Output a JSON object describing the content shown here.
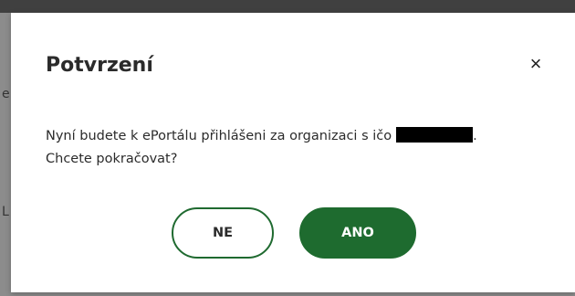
{
  "dialog": {
    "title": "Potvrzení",
    "close_symbol": "×",
    "message_line1_before_redaction": "Nyní budete k ePortálu přihlášeni za organizaci s ičo",
    "message_line1_after_redaction": ".",
    "message_line2": "Chcete pokračovat?",
    "cancel_label": "NE",
    "confirm_label": "ANO"
  },
  "background": {
    "char_1": "e",
    "char_2": "L"
  },
  "colors": {
    "primary_green": "#1e6b2f",
    "overlay": "#000000"
  }
}
